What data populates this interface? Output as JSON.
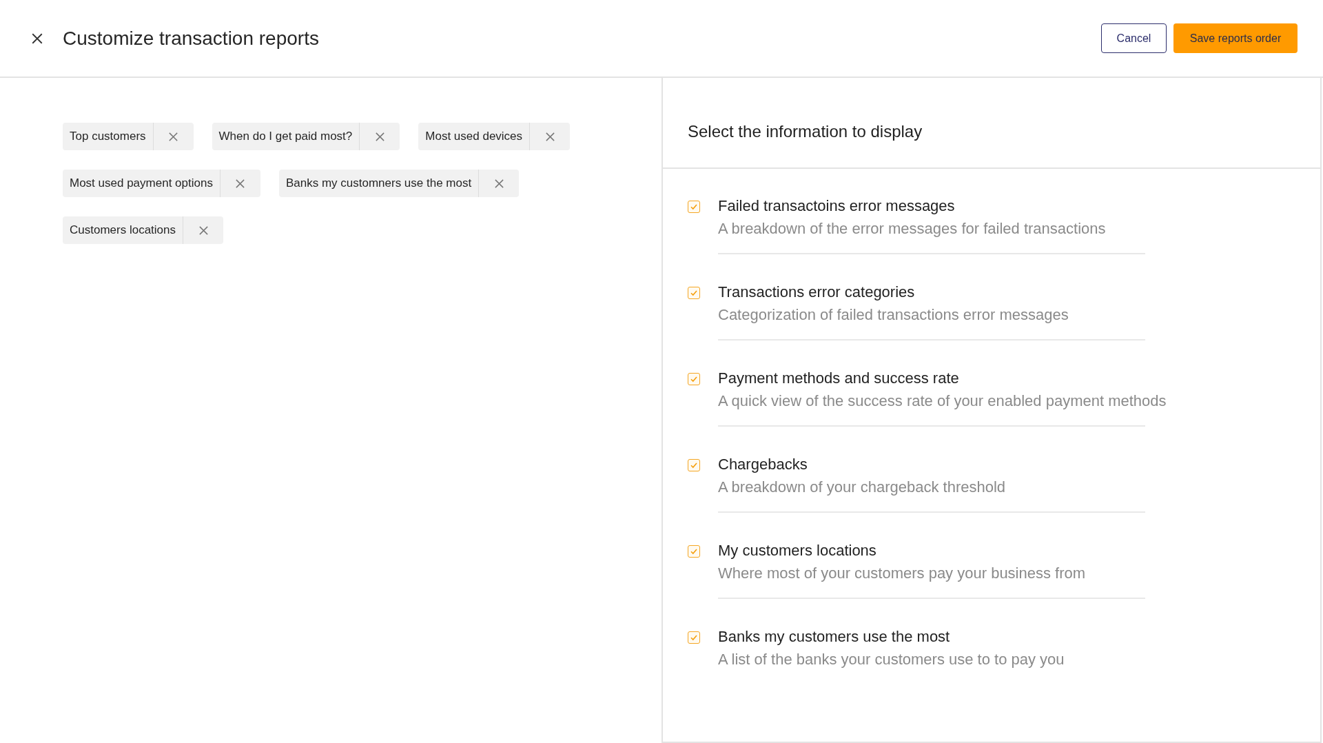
{
  "header": {
    "title": "Customize transaction reports",
    "buttons": [
      {
        "kind": "secondary",
        "label": "Cancel"
      },
      {
        "kind": "primary",
        "label": "Save reports order"
      }
    ]
  },
  "chips": [
    {
      "label": "Top customers"
    },
    {
      "label": "When do I get paid most?"
    },
    {
      "label": "Most used devices"
    },
    {
      "label": "Most used payment options"
    },
    {
      "label": "Banks my customners use the most"
    },
    {
      "label": "Customers locations"
    }
  ],
  "panel": {
    "heading": "Select the information to display",
    "options": [
      {
        "title": "Failed transactoins error messages",
        "description": "A breakdown of the error messages for failed transactions",
        "checked": true
      },
      {
        "title": "Transactions error categories",
        "description": "Categorization of failed transactions error messages",
        "checked": true
      },
      {
        "title": "Payment methods and success rate",
        "description": "A quick view of the success rate of your enabled payment methods",
        "checked": true
      },
      {
        "title": "Chargebacks",
        "description": "A breakdown of your chargeback threshold",
        "checked": true
      },
      {
        "title": "My customers locations",
        "description": "Where most of your customers pay your business from",
        "checked": true
      },
      {
        "title": "Banks my customers use the most",
        "description": "A list of the banks your customers use to to pay you",
        "checked": true
      }
    ]
  }
}
